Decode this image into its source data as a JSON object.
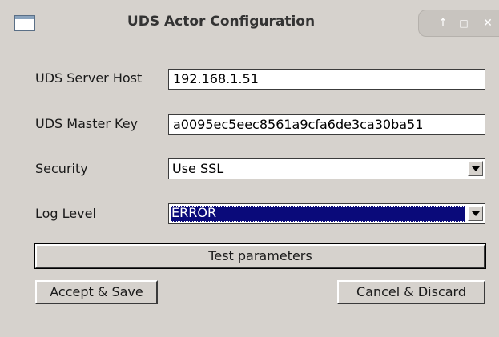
{
  "window": {
    "title": "UDS Actor Configuration",
    "controls": {
      "up_icon": "↑",
      "maximize_icon": "□",
      "close_icon": "✕"
    }
  },
  "form": {
    "server_host": {
      "label": "UDS Server Host",
      "value": "192.168.1.51"
    },
    "master_key": {
      "label": "UDS Master Key",
      "value": "a0095ec5eec8561a9cfa6de3ca30ba51"
    },
    "security": {
      "label": "Security",
      "value": "Use SSL"
    },
    "log_level": {
      "label": "Log Level",
      "value": "ERROR"
    }
  },
  "buttons": {
    "test": "Test parameters",
    "accept": "Accept & Save",
    "cancel": "Cancel & Discard"
  },
  "colors": {
    "window_bg": "#d6d2cd",
    "selection_bg": "#0a0a7a"
  }
}
